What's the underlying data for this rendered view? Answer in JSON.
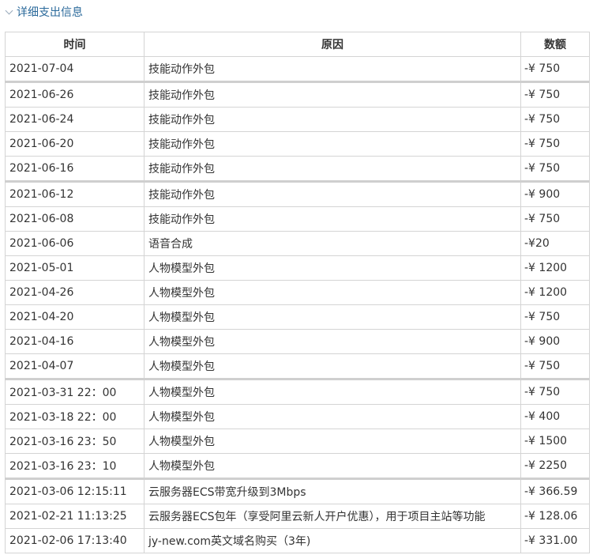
{
  "section_title": "详细支出信息",
  "headers": [
    "时间",
    "原因",
    "数额"
  ],
  "rows": [
    [
      "2021-07-04",
      "技能动作外包",
      "-¥ 750"
    ],
    [
      "2021-06-26",
      "技能动作外包",
      "-¥ 750"
    ],
    [
      "2021-06-24",
      "技能动作外包",
      "-¥ 750"
    ],
    [
      "2021-06-20",
      "技能动作外包",
      "-¥ 750"
    ],
    [
      "2021-06-16",
      "技能动作外包",
      "-¥ 750"
    ],
    [
      "2021-06-12",
      "技能动作外包",
      "-¥ 900"
    ],
    [
      "2021-06-08",
      "技能动作外包",
      "-¥ 750"
    ],
    [
      "2021-06-06",
      "语音合成",
      "-¥20"
    ],
    [
      "2021-05-01",
      "人物模型外包",
      "-¥ 1200"
    ],
    [
      "2021-04-26",
      "人物模型外包",
      "-¥ 1200"
    ],
    [
      "2021-04-20",
      "人物模型外包",
      "-¥ 750"
    ],
    [
      "2021-04-16",
      "人物模型外包",
      "-¥ 900"
    ],
    [
      "2021-04-07",
      "人物模型外包",
      "-¥ 750"
    ],
    [
      "2021-03-31 22：00",
      "人物模型外包",
      "-¥ 750"
    ],
    [
      "2021-03-18 22：00",
      "人物模型外包",
      "-¥ 400"
    ],
    [
      "2021-03-16 23：50",
      "人物模型外包",
      "-¥ 1500"
    ],
    [
      "2021-03-16 23：10",
      "人物模型外包",
      "-¥ 2250"
    ],
    [
      "2021-03-06 12:15:11",
      "云服务器ECS带宽升级到3Mbps",
      "-¥ 366.59"
    ],
    [
      "2021-02-21 11:13:25",
      "云服务器ECS包年（享受阿里云新人开户优惠），用于项目主站等功能",
      "-¥ 128.06"
    ],
    [
      "2021-02-06 17:13:40",
      "jy-new.com英文域名购买（3年)",
      "-¥ 331.00"
    ]
  ]
}
